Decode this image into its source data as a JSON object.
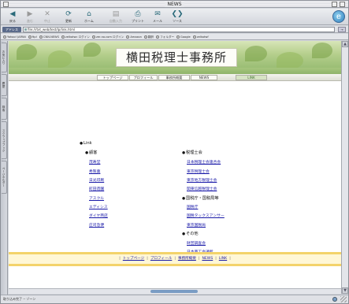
{
  "window": {
    "title": "NEWS"
  },
  "toolbar": {
    "buttons": [
      {
        "icon": "◀",
        "label": "戻る",
        "enabled": true
      },
      {
        "icon": "▶",
        "label": "進む",
        "enabled": false
      },
      {
        "icon": "✕",
        "label": "中止",
        "enabled": false
      },
      {
        "icon": "⟳",
        "label": "更新",
        "enabled": true
      },
      {
        "icon": "⌂",
        "label": "ホーム",
        "enabled": true
      },
      {
        "icon": "▤",
        "label": "自動入力",
        "enabled": false
      },
      {
        "icon": "⎙",
        "label": "プリント",
        "enabled": true
      },
      {
        "icon": "✉",
        "label": "メール",
        "enabled": true
      },
      {
        "icon": "❮❯",
        "label": "ソース",
        "enabled": true
      }
    ],
    "logo": "e"
  },
  "address": {
    "label": "アドレス",
    "value": "file:///txt_web/test/lp/link.html",
    "go": "→"
  },
  "favorites": [
    "Yahoo! JAPAN",
    "ftp!",
    "CNN.NEWS",
    "zelkotwc ログイン",
    "zer-no.com ログイン",
    "Amazon",
    "翻訳",
    "フォルダー",
    "Google",
    "zelkotwf"
  ],
  "sidetabs": [
    "お気に入り",
    "履歴",
    "検索",
    "スクラップブック",
    "ページホルダー"
  ],
  "page": {
    "site_title": "横田税理士事務所",
    "nav": [
      "トップページ",
      "プロフィール",
      "事務所概要",
      "NEWS",
      "LINK"
    ],
    "link_heading": "Link",
    "left_group": {
      "heading": "顧客",
      "links": [
        "茂寿堂",
        "秀製菓",
        "日光印刷",
        "町田造園",
        "アスクル",
        "エディシス",
        "ダイヤ商店",
        "庄司急便"
      ]
    },
    "right_groups": [
      {
        "heading": "税理士会",
        "links": [
          "日本税理士会連合会",
          "東京税理士会",
          "東京地方税理士会",
          "関東信越税理士会"
        ]
      },
      {
        "heading": "国税庁・国税局等",
        "links": [
          "国税庁",
          "国税タックスアンサー",
          "東京国税局"
        ]
      },
      {
        "heading": "その他",
        "links": [
          "財団調査会",
          "日本商工会議所"
        ]
      }
    ],
    "footer": [
      "トップページ",
      "プロフィール",
      "事務所概要",
      "NEWS",
      "LINK"
    ]
  },
  "status": {
    "text": "取り込み完了 -- ゾーン"
  }
}
